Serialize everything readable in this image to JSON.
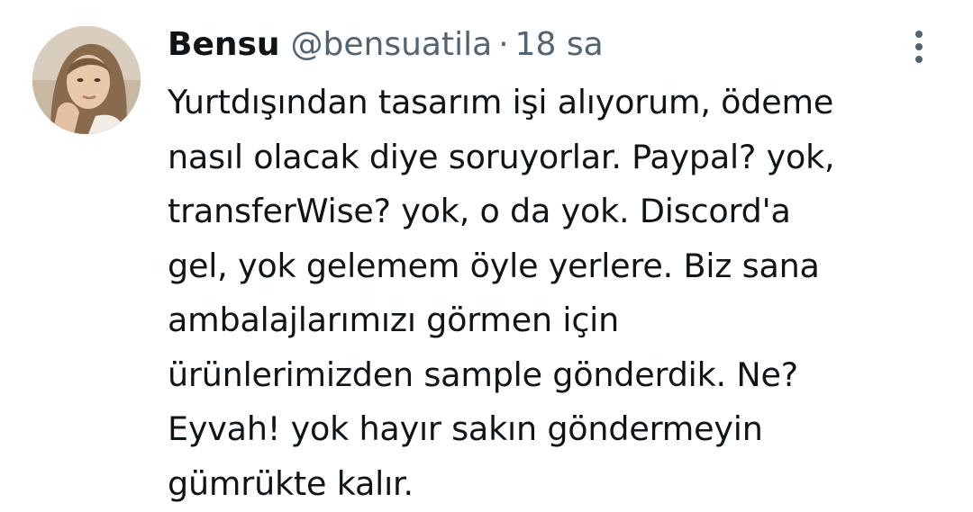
{
  "author": {
    "display_name": "Bensu",
    "handle": "@bensuatila",
    "separator": "·",
    "timestamp": "18 sa"
  },
  "icons": {
    "avatar": "profile-photo",
    "more": "more-vertical-icon"
  },
  "colors": {
    "text_primary": "#0f1419",
    "text_secondary": "#536471",
    "background": "#ffffff"
  },
  "tweet": {
    "lines": [
      "Yurtdışından tasarım işi alıyorum, ödeme",
      "nasıl olacak diye soruyorlar. Paypal? yok,",
      "transferWise? yok, o da yok. Discord'a",
      "gel, yok gelemem öyle yerlere. Biz sana",
      "ambalajlarımızı görmen için",
      "ürünlerimizden sample gönderdik. Ne?",
      "Eyvah! yok hayır sakın göndermeyin",
      "gümrükte kalır."
    ]
  }
}
